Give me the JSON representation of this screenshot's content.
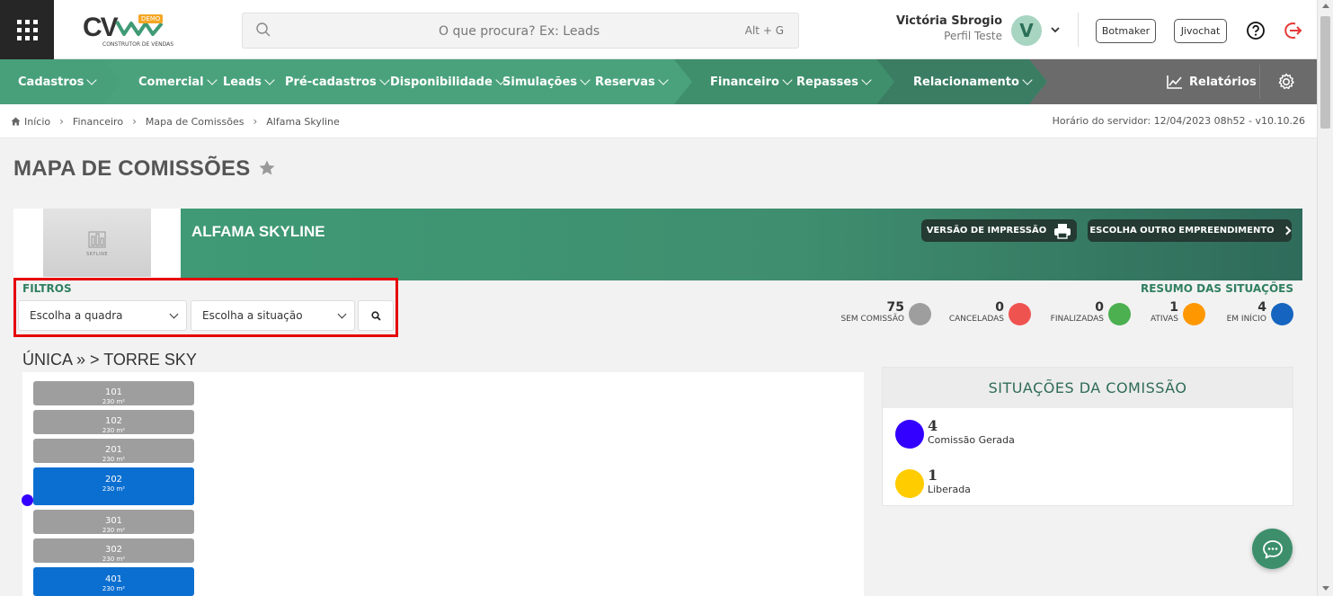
{
  "header": {
    "logo_text": "CV",
    "logo_badge": "DEMO",
    "logo_subtitle": "CONSTRUTOR DE VENDAS",
    "search_placeholder": "O que procura? Ex: Leads",
    "search_shortcut": "Alt + G",
    "user_name": "Victória Sbrogio",
    "user_role": "Perfil Teste",
    "avatar_initial": "V",
    "botmaker_label": "Botmaker",
    "jivochat_label": "Jivochat"
  },
  "nav": {
    "items": [
      {
        "label": "Cadastros"
      },
      {
        "label": "Comercial"
      },
      {
        "label": "Leads"
      },
      {
        "label": "Pré-cadastros"
      },
      {
        "label": "Disponibilidade"
      },
      {
        "label": "Simulações"
      },
      {
        "label": "Reservas"
      },
      {
        "label": "Financeiro"
      },
      {
        "label": "Repasses"
      },
      {
        "label": "Relacionamento"
      }
    ],
    "reports_label": "Relatórios"
  },
  "breadcrumb": {
    "items": [
      "Início",
      "Financeiro",
      "Mapa de Comissões",
      "Alfama Skyline"
    ],
    "server_time": "Horário do servidor: 12/04/2023 08h52 - v10.10.26"
  },
  "page": {
    "title": "MAPA DE COMISSÕES"
  },
  "project": {
    "name": "ALFAMA SKYLINE",
    "thumb_label": "SKYLINE",
    "print_label": "VERSÃO DE IMPRESSÃO",
    "change_label": "ESCOLHA OUTRO EMPREENDIMENTO"
  },
  "filters": {
    "label": "FILTROS",
    "quadra_placeholder": "Escolha a quadra",
    "situacao_placeholder": "Escolha a situação"
  },
  "summary": {
    "label": "RESUMO DAS SITUAÇÕES",
    "items": [
      {
        "count": "75",
        "label": "SEM COMISSÃO",
        "color": "#9e9e9e"
      },
      {
        "count": "0",
        "label": "CANCELADAS",
        "color": "#ef5350"
      },
      {
        "count": "0",
        "label": "FINALIZADAS",
        "color": "#4caf50"
      },
      {
        "count": "1",
        "label": "ATIVAS",
        "color": "#ff9800"
      },
      {
        "count": "4",
        "label": "EM INÍCIO",
        "color": "#1565c0"
      }
    ]
  },
  "section": {
    "title": "ÚNICA » > TORRE SKY"
  },
  "units": [
    {
      "num": "101",
      "area": "230 m²",
      "color": "#9e9e9e",
      "dot_color": ""
    },
    {
      "num": "102",
      "area": "230 m²",
      "color": "#9e9e9e",
      "dot_color": ""
    },
    {
      "num": "201",
      "area": "230 m²",
      "color": "#9e9e9e",
      "dot_color": ""
    },
    {
      "num": "202",
      "area": "230 m²",
      "color": "#0b6fd1",
      "dot_color": "#3300ff"
    },
    {
      "num": "301",
      "area": "230 m²",
      "color": "#9e9e9e",
      "dot_color": ""
    },
    {
      "num": "302",
      "area": "230 m²",
      "color": "#9e9e9e",
      "dot_color": ""
    },
    {
      "num": "401",
      "area": "230 m²",
      "color": "#0b6fd1",
      "dot_color": ""
    }
  ],
  "situations": {
    "title": "SITUAÇÕES DA COMISSÃO",
    "items": [
      {
        "count": "4",
        "label": "Comissão Gerada",
        "color": "#3300ff"
      },
      {
        "count": "1",
        "label": "Liberada",
        "color": "#ffcc00"
      }
    ]
  },
  "colors": {
    "brand_green": "#48a07b",
    "nav_dark": "#3a7d63",
    "nav_gray": "#6b6b6b",
    "highlight_red": "#e60000"
  }
}
